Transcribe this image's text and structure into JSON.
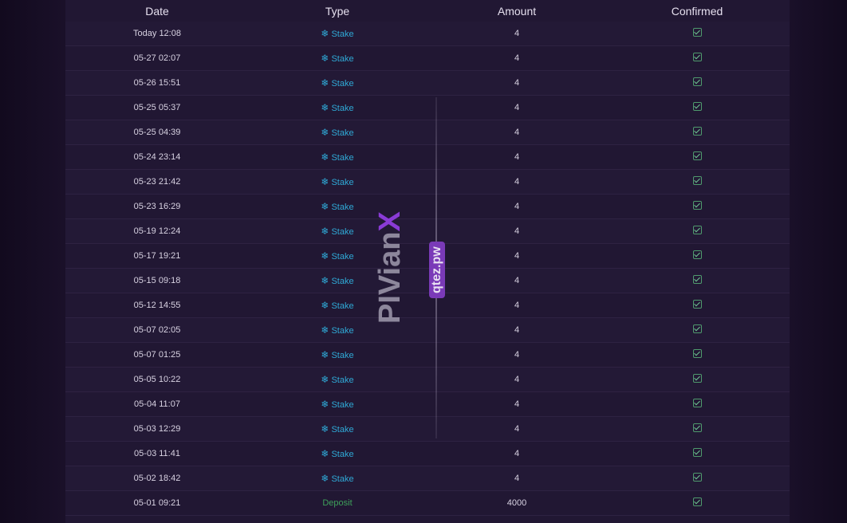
{
  "table": {
    "headers": [
      "Date",
      "Type",
      "Amount",
      "Confirmed"
    ],
    "rows": [
      {
        "date": "Today 12:08",
        "type": "Stake",
        "amount": "4"
      },
      {
        "date": "05-27 02:07",
        "type": "Stake",
        "amount": "4"
      },
      {
        "date": "05-26 15:51",
        "type": "Stake",
        "amount": "4"
      },
      {
        "date": "05-25 05:37",
        "type": "Stake",
        "amount": "4"
      },
      {
        "date": "05-25 04:39",
        "type": "Stake",
        "amount": "4"
      },
      {
        "date": "05-24 23:14",
        "type": "Stake",
        "amount": "4"
      },
      {
        "date": "05-23 21:42",
        "type": "Stake",
        "amount": "4"
      },
      {
        "date": "05-23 16:29",
        "type": "Stake",
        "amount": "4"
      },
      {
        "date": "05-19 12:24",
        "type": "Stake",
        "amount": "4"
      },
      {
        "date": "05-17 19:21",
        "type": "Stake",
        "amount": "4"
      },
      {
        "date": "05-15 09:18",
        "type": "Stake",
        "amount": "4"
      },
      {
        "date": "05-12 14:55",
        "type": "Stake",
        "amount": "4"
      },
      {
        "date": "05-07 02:05",
        "type": "Stake",
        "amount": "4"
      },
      {
        "date": "05-07 01:25",
        "type": "Stake",
        "amount": "4"
      },
      {
        "date": "05-05 10:22",
        "type": "Stake",
        "amount": "4"
      },
      {
        "date": "05-04 11:07",
        "type": "Stake",
        "amount": "4"
      },
      {
        "date": "05-03 12:29",
        "type": "Stake",
        "amount": "4"
      },
      {
        "date": "05-03 11:41",
        "type": "Stake",
        "amount": "4"
      },
      {
        "date": "05-02 18:42",
        "type": "Stake",
        "amount": "4"
      },
      {
        "date": "05-01 09:21",
        "type": "Deposit",
        "amount": "4000"
      }
    ]
  },
  "watermark": {
    "main_text": "PIVian",
    "main_accent": "X",
    "sub_text": "qtez.pw"
  },
  "colors": {
    "stake": "#2fa9d6",
    "deposit": "#3ea05a",
    "confirmed": "#6fc493"
  },
  "icons": {
    "stake": "snowflake-icon",
    "confirmed": "checkbox-checked-icon"
  }
}
